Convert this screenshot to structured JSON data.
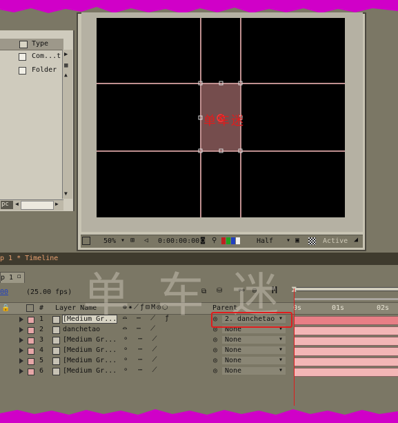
{
  "project_panel": {
    "column_type": "Type",
    "items": [
      {
        "type": "Com...t"
      },
      {
        "type": "Folder"
      }
    ],
    "bpc_label": "pc"
  },
  "viewer": {
    "zoom": "50%",
    "timecode": "0:00:00:00",
    "resolution": "Half",
    "camera": "Active",
    "logo_text": "单车迷"
  },
  "timeline": {
    "title": "p 1 * Timeline",
    "tab": "p 1",
    "timecode": "00",
    "fps": "(25.00 fps)",
    "m_label": "M",
    "columns": {
      "num": "#",
      "layer_name": "Layer Name",
      "parent": "Parent"
    },
    "ruler": [
      "0s",
      "01s",
      "02s"
    ],
    "layers": [
      {
        "num": "1",
        "name": "[Medium Gr...",
        "parent": "2. danchetao"
      },
      {
        "num": "2",
        "name": "danchetao",
        "parent": "None"
      },
      {
        "num": "3",
        "name": "[Medium Gr...",
        "parent": "None"
      },
      {
        "num": "4",
        "name": "[Medium Gr...",
        "parent": "None"
      },
      {
        "num": "5",
        "name": "[Medium Gr...",
        "parent": "None"
      },
      {
        "num": "6",
        "name": "[Medium Gr...",
        "parent": "None"
      }
    ],
    "watermark": "单车迷"
  },
  "colors": {
    "accent_red": "#e01c1c",
    "magenta_border": "#d000c8",
    "layer_bar": "#f3b6b6"
  }
}
